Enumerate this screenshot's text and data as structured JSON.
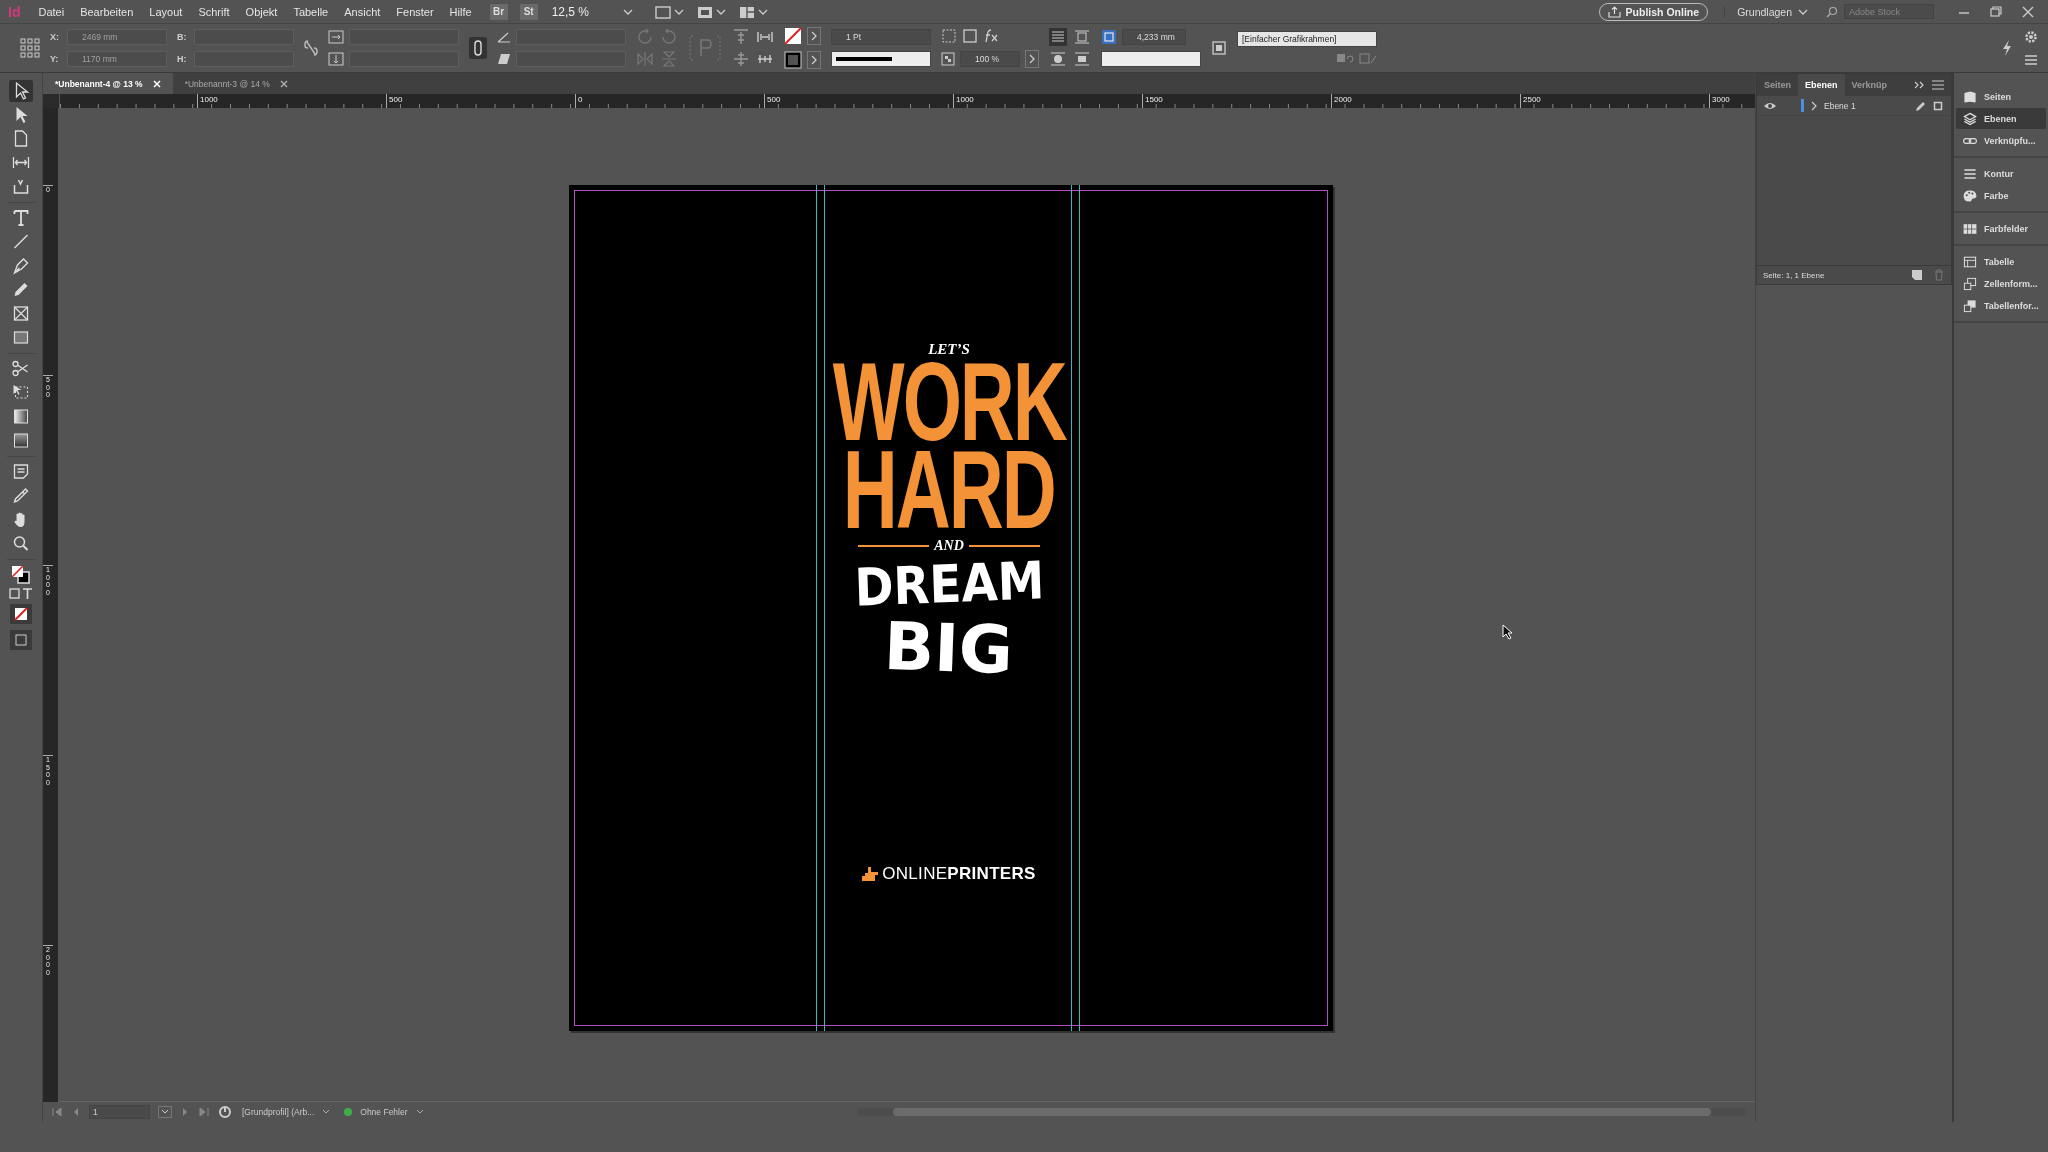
{
  "app_logo": "Id",
  "menu": [
    "Datei",
    "Bearbeiten",
    "Layout",
    "Schrift",
    "Objekt",
    "Tabelle",
    "Ansicht",
    "Fenster",
    "Hilfe"
  ],
  "bridge_buttons": [
    "Br",
    "St"
  ],
  "zoom": "12,5 %",
  "publish_button": "Publish Online",
  "workspace": "Grundlagen",
  "search": {
    "placeholder": "Adobe Stock"
  },
  "control_bar": {
    "position": [
      {
        "label": "X:",
        "value": "2469 mm",
        "disabled": true
      },
      {
        "label": "Y:",
        "value": "1170 mm",
        "disabled": true
      }
    ],
    "size": [
      {
        "label": "B:",
        "disabled": true
      },
      {
        "label": "H:",
        "disabled": true
      }
    ],
    "stroke_weight": "1 Pt",
    "opacity": "100 %",
    "offset": "4,233 mm",
    "object_style": "[Einfacher Grafikrahmen]"
  },
  "doc_tabs": [
    {
      "label": "*Unbenannt-4 @ 13 %",
      "selected": true
    },
    {
      "label": "*Unbenannt-3 @ 14 %",
      "selected": false
    }
  ],
  "ruler_h": [
    "1000",
    "500",
    "0",
    "500",
    "1000",
    "1500",
    "2000",
    "2500",
    "3000"
  ],
  "ruler_v": [
    "0",
    "500",
    "1000",
    "1500",
    "2000"
  ],
  "tools": [
    {
      "kind": "selection",
      "selected": true
    },
    {
      "kind": "direct",
      "selected": false
    },
    {
      "kind": "page",
      "selected": false
    },
    {
      "kind": "gap",
      "selected": false
    },
    {
      "kind": "collector",
      "selected": false
    },
    {
      "kind": "type",
      "selected": false
    },
    {
      "kind": "line",
      "selected": false
    },
    {
      "kind": "pen",
      "selected": false
    },
    {
      "kind": "pencil",
      "selected": false
    },
    {
      "kind": "frame",
      "selected": false
    },
    {
      "kind": "rect",
      "selected": false
    },
    {
      "kind": "scissors",
      "selected": false
    },
    {
      "kind": "transform",
      "selected": false
    },
    {
      "kind": "gradient",
      "selected": false
    },
    {
      "kind": "feather",
      "selected": false
    },
    {
      "kind": "note",
      "selected": false
    },
    {
      "kind": "eyedropper",
      "selected": false
    },
    {
      "kind": "hand",
      "selected": false
    },
    {
      "kind": "zoom",
      "selected": false
    }
  ],
  "artwork": {
    "kicker": "LET’S",
    "headline": [
      "WORK",
      "HARD"
    ],
    "joiner": "AND",
    "tagline": [
      "DREAM",
      "BIG"
    ],
    "logo": "ONLINE**PRINTERS**"
  },
  "layers_panel": {
    "tabs": [
      {
        "label": "Seiten",
        "selected": false
      },
      {
        "label": "Ebenen",
        "selected": true
      },
      {
        "label": "Verknüp",
        "selected": false
      }
    ],
    "layers": [
      {
        "name": "Ebene 1",
        "visible": true,
        "color": "#4a8fe0"
      }
    ],
    "footer": "Seite: 1, 1 Ebene"
  },
  "dock": [
    [
      {
        "kind": "pages",
        "label": "Seiten",
        "selected": false
      },
      {
        "kind": "layers",
        "label": "Ebenen",
        "selected": true
      },
      {
        "kind": "links",
        "label": "Verknüpfu...",
        "selected": false
      }
    ],
    [
      {
        "kind": "stroke",
        "label": "Kontur",
        "selected": false
      },
      {
        "kind": "color",
        "label": "Farbe",
        "selected": false
      }
    ],
    [
      {
        "kind": "swatches",
        "label": "Farbfelder",
        "selected": false
      }
    ],
    [
      {
        "kind": "table",
        "label": "Tabelle",
        "selected": false
      },
      {
        "kind": "cellstyle",
        "label": "Zellenform...",
        "selected": false
      },
      {
        "kind": "tablestyle",
        "label": "Tabellenfor...",
        "selected": false
      }
    ]
  ],
  "status_bar": {
    "page": "1",
    "profile": "[Grundprofil] (Arb...",
    "preflight": {
      "label": "Ohne Fehler",
      "color": "#3fae49"
    }
  }
}
